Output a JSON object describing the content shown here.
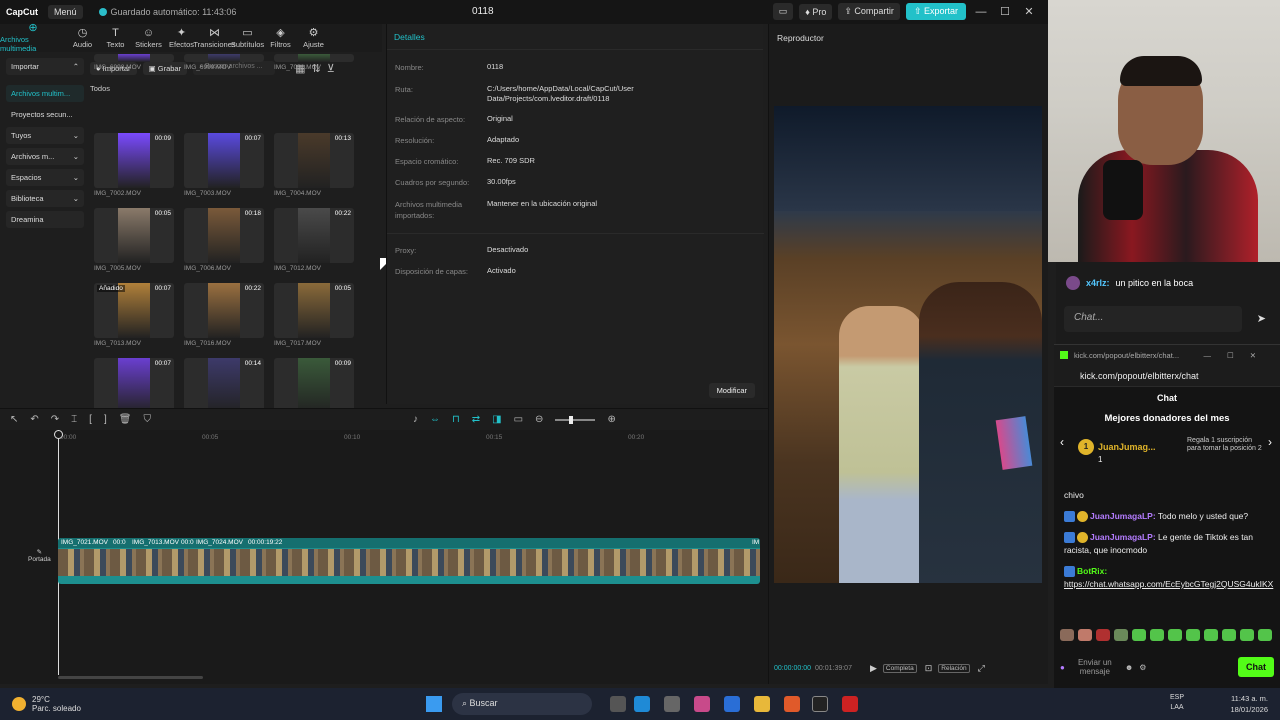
{
  "titlebar": {
    "logo": "CapCut",
    "menu": "Menú",
    "autosave": "Guardado automático: 11:43:06",
    "project": "0118",
    "pro": "Pro",
    "share": "Compartir",
    "export": "Exportar"
  },
  "media_tabs": [
    {
      "label": "Archivos multimedia",
      "icon": "media-icon",
      "glyph": "⊕"
    },
    {
      "label": "Audio",
      "icon": "audio-icon",
      "glyph": "◷"
    },
    {
      "label": "Texto",
      "icon": "text-icon",
      "glyph": "T"
    },
    {
      "label": "Stickers",
      "icon": "sticker-icon",
      "glyph": "☺"
    },
    {
      "label": "Efectos",
      "icon": "effects-icon",
      "glyph": "✦"
    },
    {
      "label": "Transiciones",
      "icon": "transitions-icon",
      "glyph": "⋈"
    },
    {
      "label": "Subtítulos",
      "icon": "subtitles-icon",
      "glyph": "▭"
    },
    {
      "label": "Filtros",
      "icon": "filters-icon",
      "glyph": "◈"
    },
    {
      "label": "Ajuste",
      "icon": "adjust-icon",
      "glyph": "⚙"
    }
  ],
  "sidebar": {
    "items": [
      {
        "label": "Importar",
        "chevron": "⌃",
        "style": "box"
      },
      {
        "label": "Archivos multim...",
        "chevron": "",
        "style": "active"
      },
      {
        "label": "Proyectos secun...",
        "chevron": "",
        "style": "plain"
      },
      {
        "label": "Tuyos",
        "chevron": "⌄",
        "style": "box"
      },
      {
        "label": "Archivos m...",
        "chevron": "⌄",
        "style": "box"
      },
      {
        "label": "Espacios",
        "chevron": "⌄",
        "style": "box"
      },
      {
        "label": "Biblioteca",
        "chevron": "⌄",
        "style": "box"
      },
      {
        "label": "Dreamina",
        "chevron": "",
        "style": "box"
      }
    ]
  },
  "media": {
    "import_btn": "Importar",
    "record_btn": "Grabar",
    "search_placeholder": "Buscar archivos ...",
    "section": "Todos",
    "items": [
      {
        "name": "IMG_6998.MOV",
        "duration": "",
        "badge": ""
      },
      {
        "name": "IMG_6999.MOV",
        "duration": "",
        "badge": ""
      },
      {
        "name": "IMG_7001.MOV",
        "duration": "",
        "badge": ""
      },
      {
        "name": "IMG_7002.MOV",
        "duration": "00:09",
        "badge": ""
      },
      {
        "name": "IMG_7003.MOV",
        "duration": "00:07",
        "badge": ""
      },
      {
        "name": "IMG_7004.MOV",
        "duration": "00:13",
        "badge": ""
      },
      {
        "name": "IMG_7005.MOV",
        "duration": "00:05",
        "badge": ""
      },
      {
        "name": "IMG_7006.MOV",
        "duration": "00:18",
        "badge": ""
      },
      {
        "name": "IMG_7012.MOV",
        "duration": "00:22",
        "badge": ""
      },
      {
        "name": "IMG_7013.MOV",
        "duration": "00:07",
        "badge": "Añadido"
      },
      {
        "name": "IMG_7016.MOV",
        "duration": "00:22",
        "badge": ""
      },
      {
        "name": "IMG_7017.MOV",
        "duration": "00:05",
        "badge": ""
      },
      {
        "name": "",
        "duration": "00:07",
        "badge": ""
      },
      {
        "name": "",
        "duration": "00:14",
        "badge": ""
      },
      {
        "name": "",
        "duration": "00:09",
        "badge": ""
      }
    ]
  },
  "details": {
    "title": "Detalles",
    "rows": [
      {
        "label": "Nombre:",
        "value": "0118"
      },
      {
        "label": "Ruta:",
        "value": "C:/Users/home/AppData/Local/CapCut/User Data/Projects/com.lveditor.draft/0118"
      },
      {
        "label": "Relación de aspecto:",
        "value": "Original"
      },
      {
        "label": "Resolución:",
        "value": "Adaptado"
      },
      {
        "label": "Espacio cromático:",
        "value": "Rec. 709 SDR"
      },
      {
        "label": "Cuadros por segundo:",
        "value": "30.00fps"
      },
      {
        "label": "Archivos multimedia importados:",
        "value": "Mantener en la ubicación original"
      },
      {
        "label": "Proxy:",
        "value": "Desactivado"
      },
      {
        "label": "Disposición de capas:",
        "value": "Activado"
      }
    ],
    "modify_btn": "Modificar"
  },
  "player": {
    "title": "Reproductor",
    "time_current": "00:00:00:00",
    "time_total": "00:01:39:07",
    "full_btn": "Completa",
    "ratio_btn": "Relación"
  },
  "timeline": {
    "ruler": [
      "00:00",
      "00:05",
      "00:10",
      "00:15",
      "00:20"
    ],
    "clips": [
      "IMG_7021.MOV",
      "00:0",
      "IMG_7013.MOV",
      "00:0",
      "IMG_7024.MOV",
      "00:00:19:22",
      "IM"
    ],
    "cover_label": "Portada"
  },
  "top_chat": {
    "user": "x4rlz:",
    "message": "un pitico en la boca",
    "placeholder": "Chat..."
  },
  "kick": {
    "window_title": "kick.com/popout/elbitterx/chat...",
    "url": "kick.com/popout/elbitterx/chat",
    "chat_title": "Chat",
    "donors_title": "Mejores donadores del mes",
    "top_donor": "JuanJumag...",
    "top_donor_amount": "1",
    "gift_text": "Regala 1 suscripción para tomar la posición 2",
    "messages": [
      {
        "user": "",
        "text": "chivo",
        "color": "plain"
      },
      {
        "user": "JuanJumagaLP:",
        "text": "Todo melo y usted que?",
        "color": "purple"
      },
      {
        "user": "JuanJumagaLP:",
        "text": "Le gente de Tiktok es tan racista, que inocmodo",
        "color": "purple"
      },
      {
        "user": "BotRix:",
        "text": "https://chat.whatsapp.com/EcEybcGTegj2QUSG4ukIKX",
        "color": "green"
      }
    ],
    "send_placeholder": "Enviar un mensaje",
    "chat_btn": "Chat"
  },
  "taskbar": {
    "temp": "29°C",
    "weather": "Parc. soleado",
    "search": "Buscar",
    "lang1": "ESP",
    "lang2": "LAA",
    "time": "11:43 a. m.",
    "date": "18/01/2026"
  },
  "colors": {
    "accent": "#22c1c9",
    "kick_green": "#53fc18",
    "donor_gold": "#e0b42a"
  }
}
